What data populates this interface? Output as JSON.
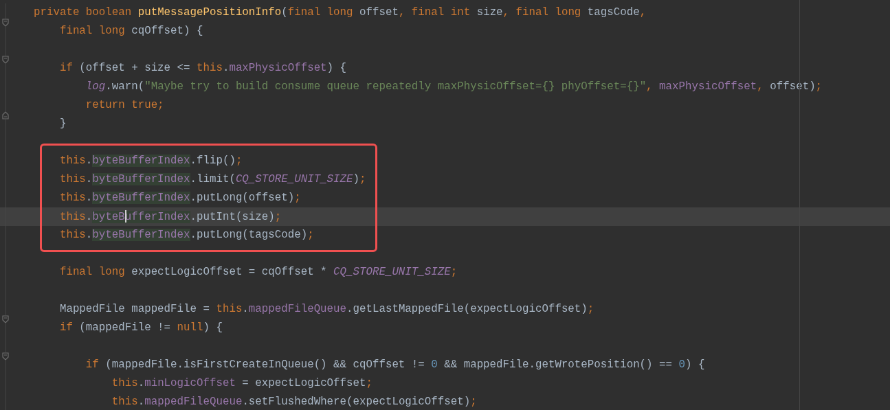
{
  "editor": {
    "lines": [
      {
        "kind": "code",
        "boxed": false,
        "current": false,
        "tokens": [
          {
            "kind": "kw",
            "text": "private boolean "
          },
          {
            "kind": "decl",
            "text": "putMessagePositionInfo"
          },
          {
            "kind": "plain",
            "text": "("
          },
          {
            "kind": "kw",
            "text": "final long "
          },
          {
            "kind": "plain",
            "text": "offset"
          },
          {
            "kind": "kw",
            "text": ", final int "
          },
          {
            "kind": "plain",
            "text": "size"
          },
          {
            "kind": "kw",
            "text": ", final long "
          },
          {
            "kind": "plain",
            "text": "tagsCode"
          },
          {
            "kind": "kw",
            "text": ","
          }
        ]
      },
      {
        "kind": "fold-start",
        "boxed": false,
        "current": false,
        "tokens": [
          {
            "kind": "kw",
            "text": "    final long "
          },
          {
            "kind": "plain",
            "text": "cqOffset) {"
          }
        ]
      },
      {
        "kind": "code",
        "boxed": false,
        "current": false
      },
      {
        "kind": "fold-start",
        "boxed": false,
        "current": false,
        "tokens": [
          {
            "kind": "kw",
            "text": "    if "
          },
          {
            "kind": "plain",
            "text": "(offset + size <= "
          },
          {
            "kind": "kw",
            "text": "this"
          },
          {
            "kind": "plain",
            "text": "."
          },
          {
            "kind": "field",
            "text": "maxPhysicOffset"
          },
          {
            "kind": "plain",
            "text": ") {"
          }
        ]
      },
      {
        "kind": "code",
        "boxed": false,
        "current": false,
        "tokens": [
          {
            "kind": "static",
            "text": "        log"
          },
          {
            "kind": "plain",
            "text": ".warn("
          },
          {
            "kind": "string",
            "text": "\"Maybe try to build consume queue repeatedly maxPhysicOffset={} phyOffset={}\""
          },
          {
            "kind": "kw",
            "text": ", "
          },
          {
            "kind": "field",
            "text": "maxPhysicOffset"
          },
          {
            "kind": "kw",
            "text": ", "
          },
          {
            "kind": "plain",
            "text": "offset)"
          },
          {
            "kind": "kw",
            "text": ";"
          }
        ]
      },
      {
        "kind": "code",
        "boxed": false,
        "current": false,
        "tokens": [
          {
            "kind": "kw",
            "text": "        return true;"
          }
        ]
      },
      {
        "kind": "fold-end",
        "boxed": false,
        "current": false,
        "tokens": [
          {
            "kind": "plain",
            "text": "    }"
          }
        ]
      },
      {
        "kind": "code",
        "boxed": false,
        "current": false
      },
      {
        "kind": "code",
        "boxed": true,
        "current": false,
        "tokens": [
          {
            "kind": "kw",
            "text": "    this"
          },
          {
            "kind": "plain",
            "text": "."
          },
          {
            "kind": "field",
            "text": "byteBufferIndex",
            "hl": true
          },
          {
            "kind": "plain",
            "text": ".flip()"
          },
          {
            "kind": "kw",
            "text": ";"
          }
        ]
      },
      {
        "kind": "code",
        "boxed": true,
        "current": false,
        "tokens": [
          {
            "kind": "kw",
            "text": "    this"
          },
          {
            "kind": "plain",
            "text": "."
          },
          {
            "kind": "field",
            "text": "byteBufferIndex",
            "hl": true
          },
          {
            "kind": "plain",
            "text": ".limit("
          },
          {
            "kind": "const",
            "text": "CQ_STORE_UNIT_SIZE"
          },
          {
            "kind": "plain",
            "text": ")"
          },
          {
            "kind": "kw",
            "text": ";"
          }
        ]
      },
      {
        "kind": "code",
        "boxed": true,
        "current": false,
        "tokens": [
          {
            "kind": "kw",
            "text": "    this"
          },
          {
            "kind": "plain",
            "text": "."
          },
          {
            "kind": "field",
            "text": "byteBufferIndex",
            "hl": true
          },
          {
            "kind": "plain",
            "text": ".putLong(offset)"
          },
          {
            "kind": "kw",
            "text": ";"
          }
        ]
      },
      {
        "kind": "code",
        "boxed": true,
        "current": true,
        "tokens": [
          {
            "kind": "kw",
            "text": "    this"
          },
          {
            "kind": "plain",
            "text": "."
          },
          {
            "kind": "field",
            "text": "byteB",
            "hl": true,
            "caret": true
          },
          {
            "kind": "field",
            "text": "ufferIndex",
            "hl": true
          },
          {
            "kind": "plain",
            "text": ".putInt(size)"
          },
          {
            "kind": "kw",
            "text": ";"
          }
        ]
      },
      {
        "kind": "code",
        "boxed": true,
        "current": false,
        "tokens": [
          {
            "kind": "kw",
            "text": "    this"
          },
          {
            "kind": "plain",
            "text": "."
          },
          {
            "kind": "field",
            "text": "byteBufferIndex",
            "hl": true
          },
          {
            "kind": "plain",
            "text": ".putLong(tagsCode)"
          },
          {
            "kind": "kw",
            "text": ";"
          }
        ]
      },
      {
        "kind": "code",
        "boxed": false,
        "current": false
      },
      {
        "kind": "code",
        "boxed": false,
        "current": false,
        "tokens": [
          {
            "kind": "kw",
            "text": "    final long "
          },
          {
            "kind": "plain",
            "text": "expectLogicOffset = cqOffset * "
          },
          {
            "kind": "const",
            "text": "CQ_STORE_UNIT_SIZE"
          },
          {
            "kind": "kw",
            "text": ";"
          }
        ]
      },
      {
        "kind": "code",
        "boxed": false,
        "current": false
      },
      {
        "kind": "code",
        "boxed": false,
        "current": false,
        "tokens": [
          {
            "kind": "plain",
            "text": "    MappedFile mappedFile = "
          },
          {
            "kind": "kw",
            "text": "this"
          },
          {
            "kind": "plain",
            "text": "."
          },
          {
            "kind": "field",
            "text": "mappedFileQueue"
          },
          {
            "kind": "plain",
            "text": ".getLastMappedFile(expectLogicOffset)"
          },
          {
            "kind": "kw",
            "text": ";"
          }
        ]
      },
      {
        "kind": "fold-start",
        "boxed": false,
        "current": false,
        "tokens": [
          {
            "kind": "kw",
            "text": "    if "
          },
          {
            "kind": "plain",
            "text": "(mappedFile != "
          },
          {
            "kind": "kw",
            "text": "null"
          },
          {
            "kind": "plain",
            "text": ") {"
          }
        ]
      },
      {
        "kind": "code",
        "boxed": false,
        "current": false
      },
      {
        "kind": "fold-start",
        "boxed": false,
        "current": false,
        "tokens": [
          {
            "kind": "kw",
            "text": "        if "
          },
          {
            "kind": "plain",
            "text": "(mappedFile.isFirstCreateInQueue() && cqOffset != "
          },
          {
            "kind": "num",
            "text": "0"
          },
          {
            "kind": "plain",
            "text": " && mappedFile.getWrotePosition() == "
          },
          {
            "kind": "num",
            "text": "0"
          },
          {
            "kind": "plain",
            "text": ") {"
          }
        ]
      },
      {
        "kind": "code",
        "boxed": false,
        "current": false,
        "tokens": [
          {
            "kind": "kw",
            "text": "            this"
          },
          {
            "kind": "plain",
            "text": "."
          },
          {
            "kind": "field",
            "text": "minLogicOffset"
          },
          {
            "kind": "plain",
            "text": " = expectLogicOffset"
          },
          {
            "kind": "kw",
            "text": ";"
          }
        ]
      },
      {
        "kind": "code",
        "boxed": false,
        "current": false,
        "tokens": [
          {
            "kind": "kw",
            "text": "            this"
          },
          {
            "kind": "plain",
            "text": "."
          },
          {
            "kind": "field",
            "text": "mappedFileQueue"
          },
          {
            "kind": "plain",
            "text": ".setFlushedWhere(expectLogicOffset)"
          },
          {
            "kind": "kw",
            "text": ";"
          }
        ]
      }
    ]
  }
}
